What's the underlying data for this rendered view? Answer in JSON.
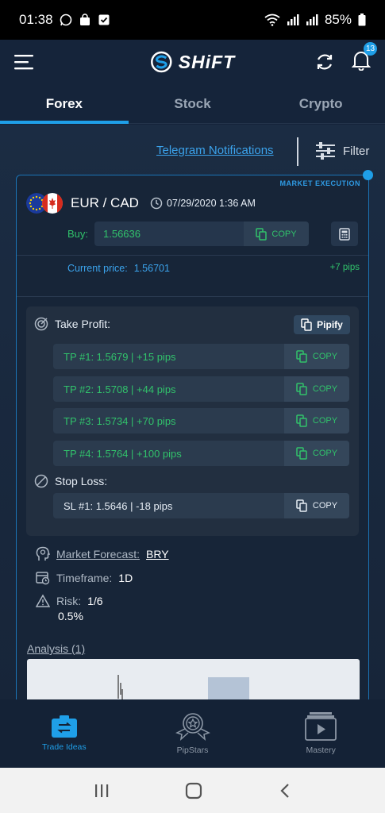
{
  "status": {
    "time": "01:38",
    "battery": "85%"
  },
  "header": {
    "brand": "SHiFT",
    "notification_count": "13"
  },
  "tabs": [
    {
      "label": "Forex"
    },
    {
      "label": "Stock"
    },
    {
      "label": "Crypto"
    }
  ],
  "toolbar": {
    "telegram": "Telegram Notifications",
    "filter": "Filter"
  },
  "signal": {
    "execution": "MARKET EXECUTION",
    "pair": "EUR / CAD",
    "datetime": "07/29/2020 1:36 AM",
    "buy_label": "Buy:",
    "buy_value": "1.56636",
    "copy": "COPY",
    "current_label": "Current price:",
    "current_value": "1.56701",
    "current_pips": "+7 pips",
    "take_profit_title": "Take Profit:",
    "pipify": "Pipify",
    "take_profits": [
      {
        "text": "TP #1: 1.5679 | +15 pips"
      },
      {
        "text": "TP #2: 1.5708 | +44 pips"
      },
      {
        "text": "TP #3: 1.5734 | +70 pips"
      },
      {
        "text": "TP #4: 1.5764 | +100 pips"
      }
    ],
    "stop_loss_title": "Stop Loss:",
    "stop_loss": "SL #1: 1.5646 | -18 pips",
    "forecast_label": "Market Forecast:",
    "forecast_value": "BRY",
    "timeframe_label": "Timeframe:",
    "timeframe_value": "1D",
    "risk_label": "Risk:",
    "risk_value": "1/6",
    "risk_percent": "0.5%",
    "analysis": "Analysis (1)"
  },
  "bottom_nav": [
    {
      "label": "Trade Ideas"
    },
    {
      "label": "PipStars"
    },
    {
      "label": "Mastery"
    }
  ],
  "colors": {
    "accent": "#1f9fe8",
    "positive": "#31c26b",
    "background": "#15243a"
  }
}
